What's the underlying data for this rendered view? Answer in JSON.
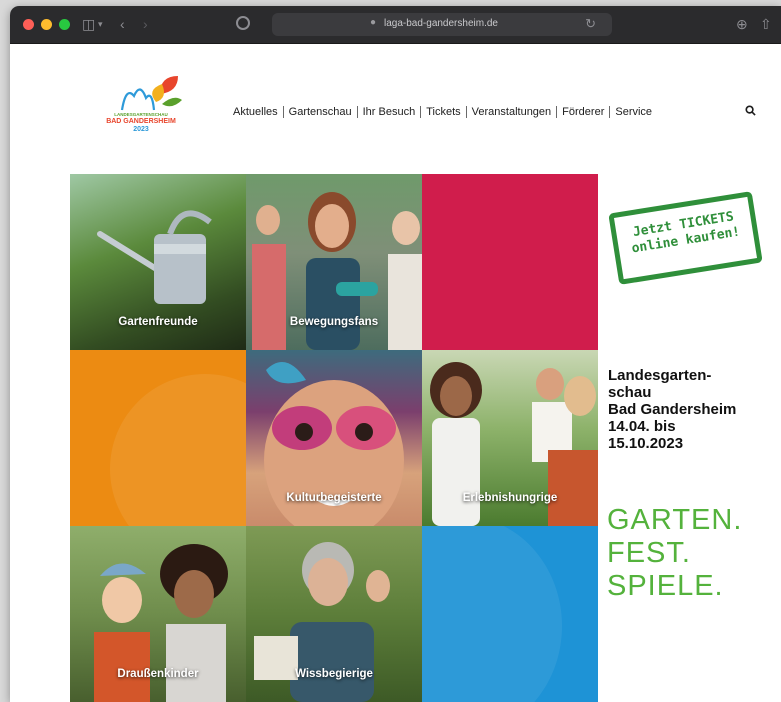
{
  "browser": {
    "url": "laga-bad-gandersheim.de",
    "icons": [
      "sidebar-icon",
      "back-icon",
      "forward-icon",
      "shield-icon",
      "lock-icon",
      "reload-icon",
      "share-icon"
    ]
  },
  "logo": {
    "line1": "LANDESGARTENSCHAU",
    "line2": "BAD GANDERSHEIM",
    "line3": "2023"
  },
  "nav": {
    "items": [
      "Aktuelles",
      "Gartenschau",
      "Ihr Besuch",
      "Tickets",
      "Veranstaltungen",
      "Förderer",
      "Service"
    ]
  },
  "tiles": [
    {
      "label": "Gartenfreunde"
    },
    {
      "label": "Bewegungsfans"
    },
    {
      "label": ""
    },
    {
      "label": ""
    },
    {
      "label": "Kulturbegeisterte"
    },
    {
      "label": "Erlebnishungrige"
    },
    {
      "label": "Draußenkinder"
    },
    {
      "label": "Wissbegierige"
    },
    {
      "label": ""
    }
  ],
  "tickets": {
    "line1": "Jetzt TICKETS",
    "line2": "online kaufen!"
  },
  "intro": {
    "line1": "Landesgarten-",
    "line2": "schau",
    "line3": "Bad Gandersheim",
    "line4": "14.04. bis",
    "line5": "15.10.2023"
  },
  "slogan": {
    "line1": "GARTEN.",
    "line2": "FEST.",
    "line3": "SPIELE."
  },
  "colors": {
    "tile_red": "#d01d4c",
    "tile_orange": "#ec8b12",
    "tile_blue": "#1e93d6",
    "brand_green": "#54b23c",
    "stamp_green": "#2f8f3a"
  }
}
